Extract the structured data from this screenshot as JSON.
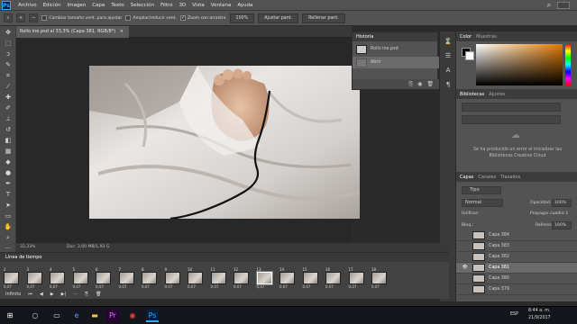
{
  "menubar": {
    "logo": "Ps",
    "items": [
      "Archivo",
      "Edición",
      "Imagen",
      "Capa",
      "Texto",
      "Selección",
      "Filtro",
      "3D",
      "Vista",
      "Ventana",
      "Ayuda"
    ]
  },
  "options": {
    "resize_windows": "Cambiar tamaño vent. para ajustar",
    "zoom_all": "Ampliar/reducir vent.",
    "scrubby_zoom": "Zoom con arrastre",
    "zoom_value": "100%",
    "fit_screen": "Ajustar pant.",
    "fill_screen": "Rellenar pant."
  },
  "document": {
    "tab_title": "Rollo ine.psd al 33,3% (Capa 381, RGB/8*)",
    "zoom": "33,33%",
    "doc_info": "Doc: 3,00 MB/1,93 G"
  },
  "history": {
    "title": "Historia",
    "snapshot": "Rollo ine.psd",
    "step": "Abrir"
  },
  "color": {
    "tab_color": "Color",
    "tab_swatches": "Muestras",
    "accent": "#e07a00"
  },
  "libraries": {
    "tab_libraries": "Bibliotecas",
    "tab_adjust": "Ajustes",
    "error": "Se ha producido un error al inicializar las Bibliotecas Creative Cloud"
  },
  "layers": {
    "tabs": [
      "Capas",
      "Canales",
      "Trazados"
    ],
    "kind": "Tipo",
    "blend": "Normal",
    "opacity_label": "Opacidad:",
    "opacity": "100%",
    "unify_label": "Unificar:",
    "propagate": "Propagar cuadro 1",
    "lock_label": "Bloq.:",
    "fill_label": "Relleno:",
    "fill": "100%",
    "items": [
      "Capa 384",
      "Capa 383",
      "Capa 382",
      "Capa 381",
      "Capa 380",
      "Capa 379"
    ]
  },
  "timeline": {
    "title": "Línea de tiempo",
    "frames": [
      "2",
      "3",
      "4",
      "5",
      "6",
      "7",
      "8",
      "9",
      "10",
      "11",
      "12",
      "13",
      "14",
      "15",
      "16",
      "17",
      "18"
    ],
    "delay": "0,07",
    "loop": "Infinito"
  },
  "taskbar": {
    "lang": "ESP",
    "time": "8:44 a. m.",
    "date": "21/9/2017"
  }
}
